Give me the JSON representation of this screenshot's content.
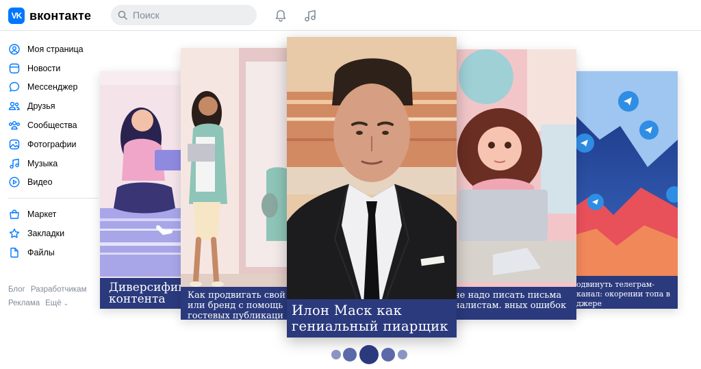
{
  "app": {
    "logo_mark": "VK",
    "logo_text": "вконтакте"
  },
  "search": {
    "placeholder": "Поиск"
  },
  "header_icons": {
    "notifications": "bell-icon",
    "music": "music-note-icon"
  },
  "sidebar": {
    "items": [
      {
        "label": "Моя страница",
        "icon": "user-icon"
      },
      {
        "label": "Новости",
        "icon": "news-icon"
      },
      {
        "label": "Мессенджер",
        "icon": "message-icon"
      },
      {
        "label": "Друзья",
        "icon": "friends-icon"
      },
      {
        "label": "Сообщества",
        "icon": "communities-icon"
      },
      {
        "label": "Фотографии",
        "icon": "photo-icon"
      },
      {
        "label": "Музыка",
        "icon": "music-icon"
      },
      {
        "label": "Видео",
        "icon": "video-icon"
      }
    ],
    "items2": [
      {
        "label": "Маркет",
        "icon": "market-icon"
      },
      {
        "label": "Закладки",
        "icon": "star-icon"
      },
      {
        "label": "Файлы",
        "icon": "file-icon"
      }
    ]
  },
  "footer": {
    "blog": "Блог",
    "developers": "Разработчикам",
    "ads": "Реклама",
    "more": "Ещё"
  },
  "carousel": {
    "cards": [
      {
        "caption": "Диверсифик контента"
      },
      {
        "caption": "Как продвигать свой или бренд с помощь гостевых публикаци"
      },
      {
        "caption": "Илон Маск как гениальный пиарщик"
      },
      {
        "caption": "не надо писать письма налистам. вных ошибок"
      },
      {
        "caption": "одвинуть телеграм-канал: окорении топа в джере"
      }
    ],
    "active_index": 2,
    "page_count": 5
  },
  "colors": {
    "accent": "#0077ff",
    "caption_bg": "#2b3a7d",
    "dot": "#2b3a7d"
  }
}
